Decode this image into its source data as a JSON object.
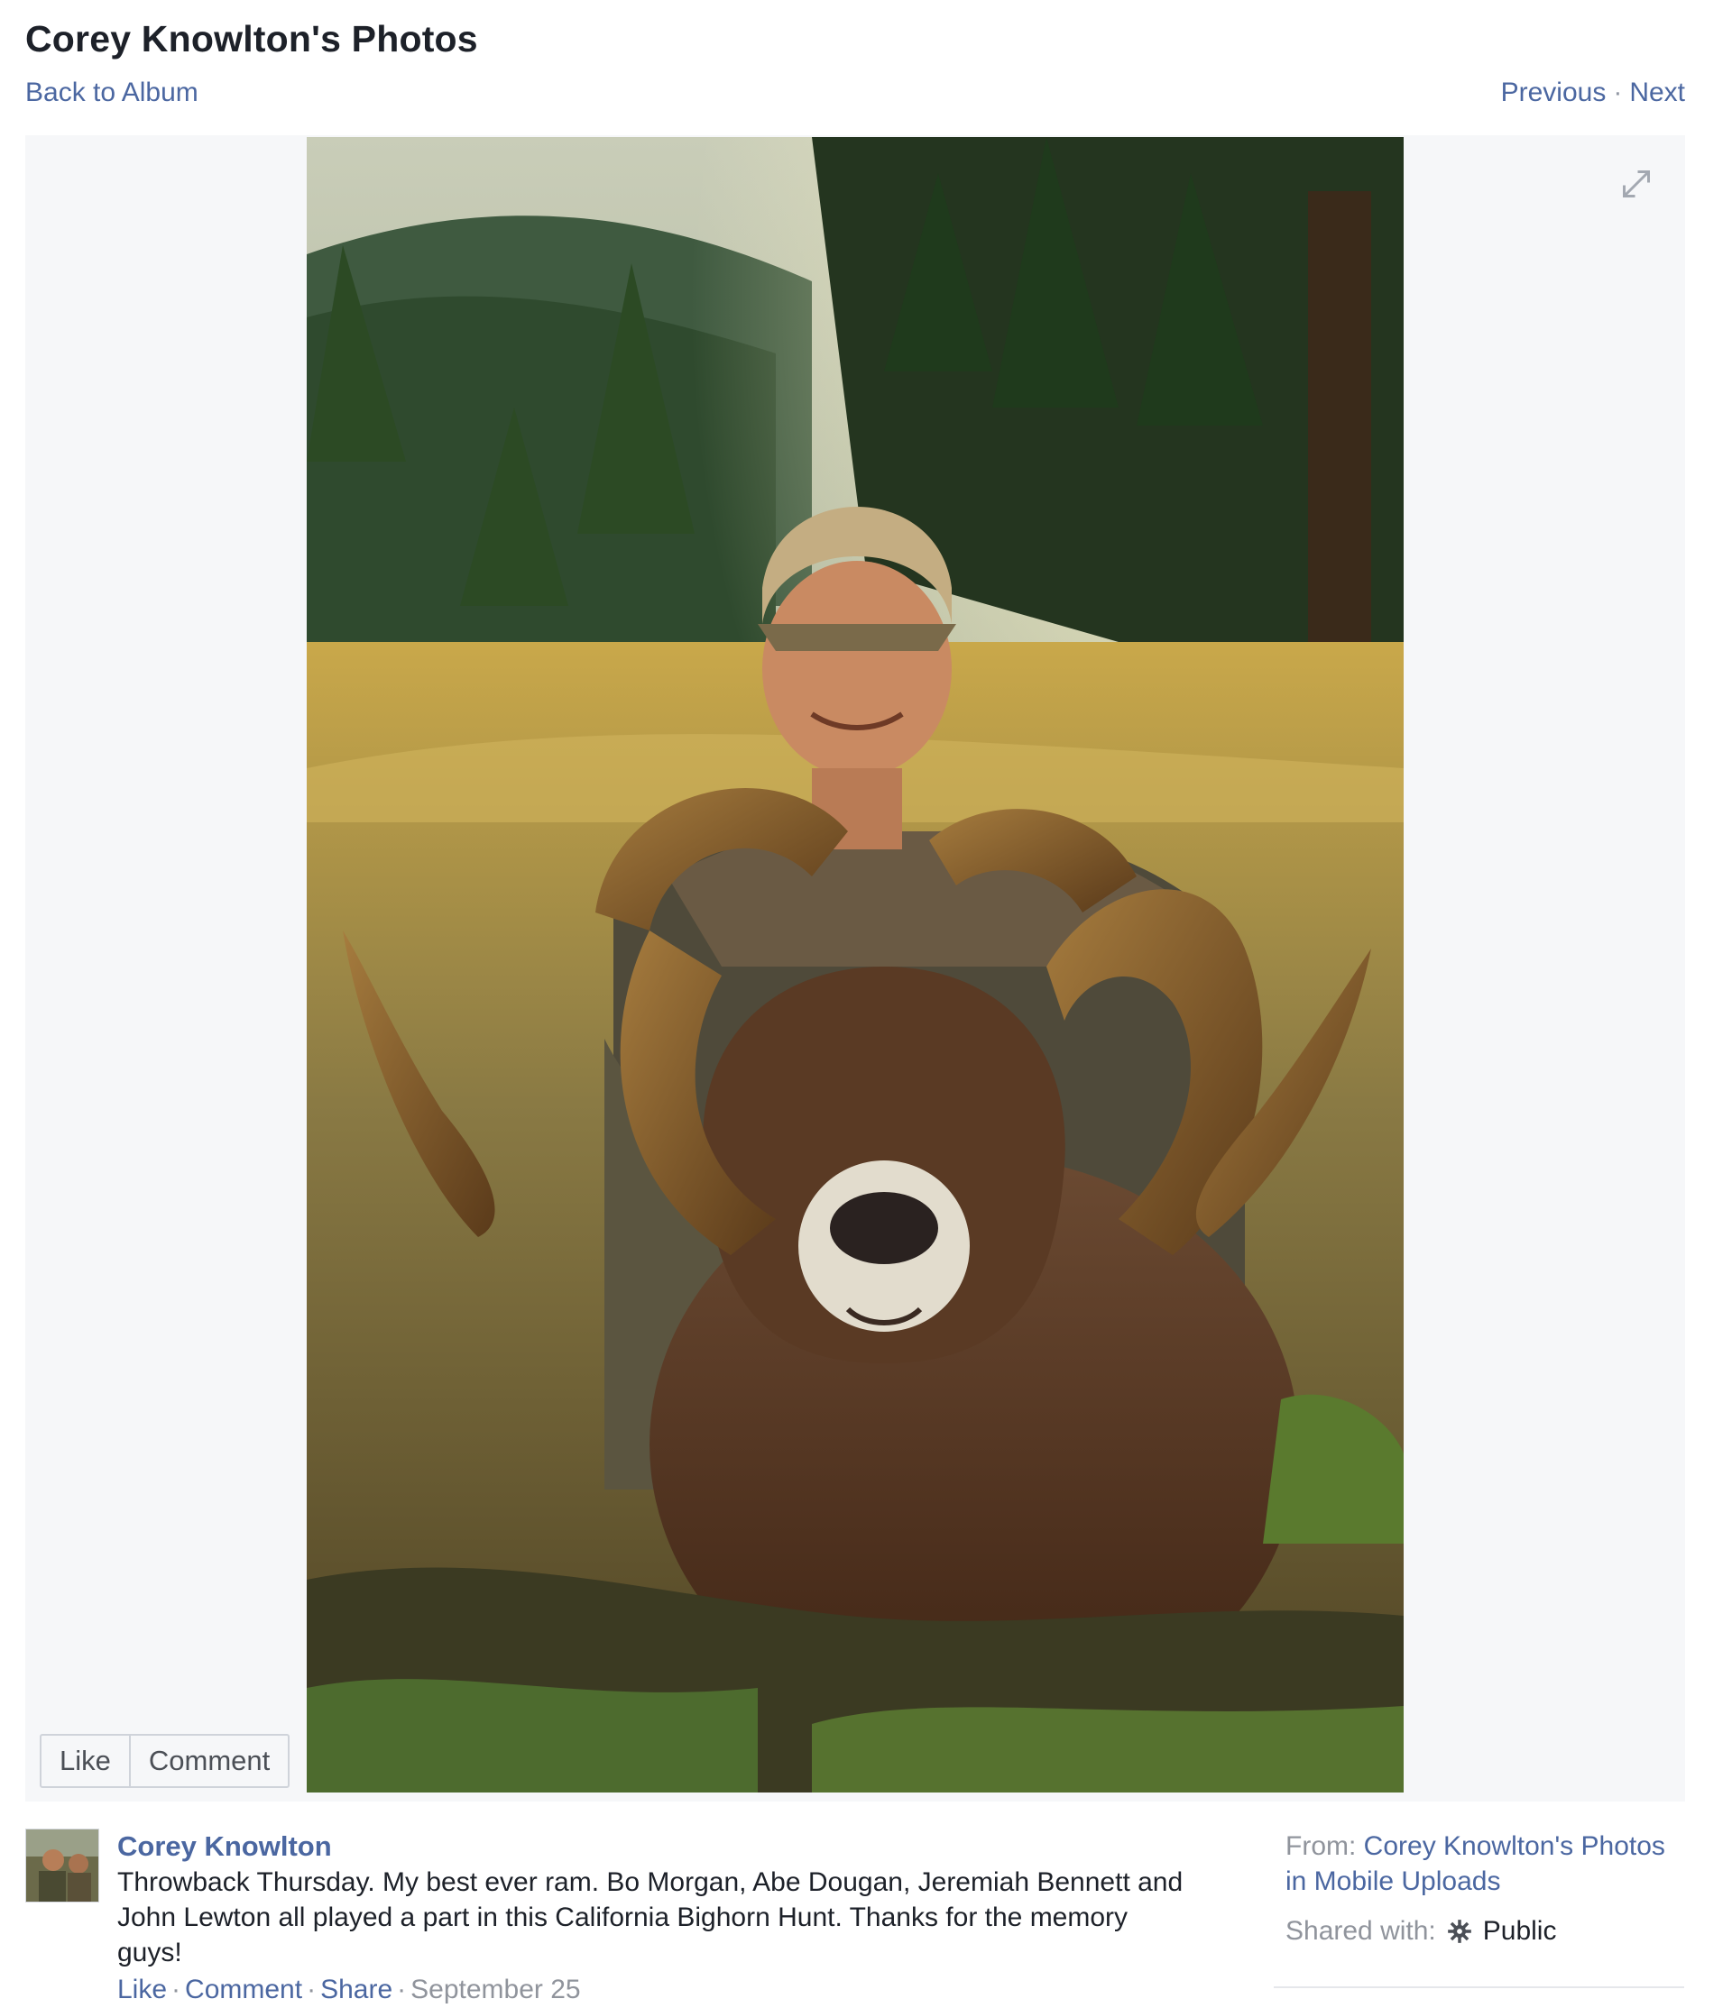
{
  "header": {
    "title": "Corey Knowlton's Photos",
    "back_link": "Back to Album",
    "previous": "Previous",
    "separator": "·",
    "next": "Next"
  },
  "photo": {
    "subject": "hunter-with-bighorn-ram-photo"
  },
  "photo_actions": {
    "like": "Like",
    "comment": "Comment"
  },
  "post": {
    "author": "Corey Knowlton",
    "caption": "Throwback Thursday. My best ever ram. Bo Morgan, Abe Dougan, Jeremiah Bennett and John Lewton all played a part in this California Bighorn Hunt. Thanks for the memory guys!",
    "actions": {
      "like": "Like",
      "comment": "Comment",
      "share": "Share",
      "separator": "·",
      "date": "September 25"
    }
  },
  "sidebar": {
    "from_label": "From:",
    "from_link": "Corey Knowlton's Photos in Mobile Uploads",
    "shared_label": "Shared with:",
    "shared_icon": "gear-icon",
    "shared_value": "Public"
  },
  "colors": {
    "link": "#4b67a1",
    "muted": "#90949c",
    "stage_bg": "#f6f7f9"
  }
}
